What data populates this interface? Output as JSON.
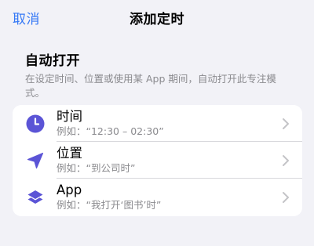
{
  "nav": {
    "cancel_label": "取消",
    "title": "添加定时"
  },
  "section": {
    "title": "自动打开",
    "description": "在设定时间、位置或使用某 App 期间，自动打开此专注模式。"
  },
  "triggers": [
    {
      "title": "时间",
      "example": "例如：“12:30 – 02:30”",
      "icon": "clock-icon"
    },
    {
      "title": "位置",
      "example": "例如：“到公司时”",
      "icon": "location-arrow-icon"
    },
    {
      "title": "App",
      "example": "例如：“我打开‘图书’时”",
      "icon": "app-layers-icon"
    }
  ],
  "colors": {
    "accent": "#3478f6",
    "icon": "#5b54d6",
    "background": "#f2f2f7",
    "secondary_text": "#8a8a8e"
  }
}
